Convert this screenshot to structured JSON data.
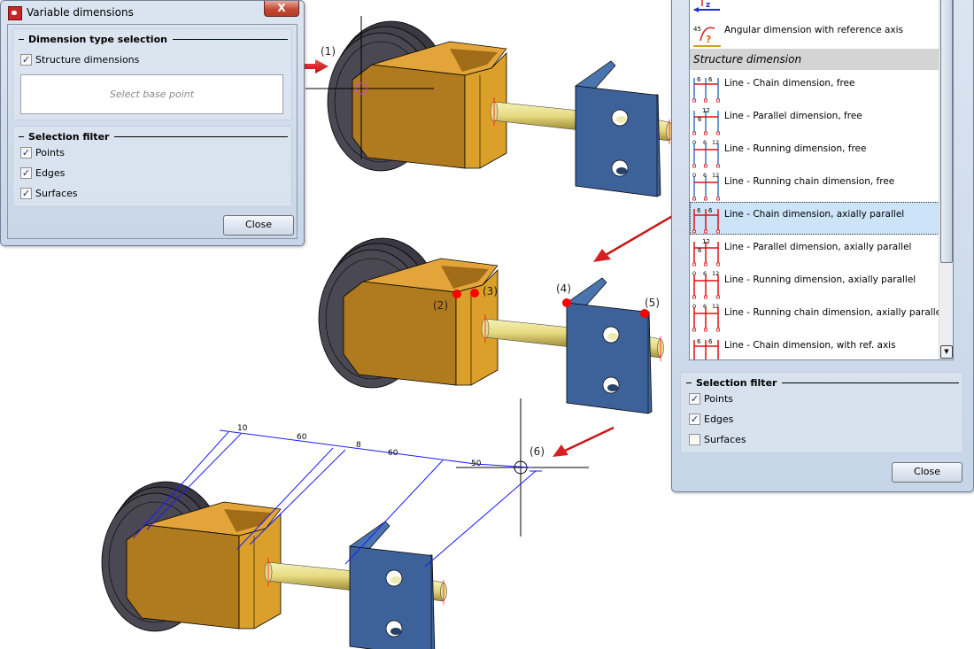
{
  "left_dialog": {
    "title": "Variable dimensions",
    "close_x": "X",
    "type_group": {
      "title": "Dimension type selection",
      "structure_dimensions": {
        "label": "Structure dimensions",
        "checked": true
      },
      "prompt": "Select base point"
    },
    "filter_group": {
      "title": "Selection filter",
      "items": [
        {
          "label": "Points",
          "checked": true
        },
        {
          "label": "Edges",
          "checked": true
        },
        {
          "label": "Surfaces",
          "checked": true
        }
      ]
    },
    "close_button": "Close"
  },
  "right_dialog": {
    "list": {
      "items_before": [
        {
          "label": "",
          "icon": "z-axis-dimension-icon"
        },
        {
          "label": "Angular dimension with reference axis",
          "icon": "angular-dimension-icon"
        }
      ],
      "category": "Structure dimension",
      "items": [
        {
          "label": "Line - Chain dimension, free",
          "icon_numbers": "6 6",
          "style": "free"
        },
        {
          "label": "Line - Parallel dimension, free",
          "icon_numbers": "12 6",
          "style": "free"
        },
        {
          "label": "Line - Running dimension, free",
          "icon_numbers": "0 6 12",
          "style": "free"
        },
        {
          "label": "Line - Running chain dimension, free",
          "icon_numbers": "0 6 12",
          "style": "free"
        },
        {
          "label": "Line - Chain dimension, axially parallel",
          "icon_numbers": "6 6",
          "style": "axial",
          "selected": true
        },
        {
          "label": "Line - Parallel dimension, axially parallel",
          "icon_numbers": "12 6",
          "style": "axial"
        },
        {
          "label": "Line - Running dimension, axially parallel",
          "icon_numbers": "0 6 12",
          "style": "axial"
        },
        {
          "label": "Line - Running chain dimension, axially parallel",
          "icon_numbers": "0 6 12",
          "style": "axial"
        },
        {
          "label": "Line - Chain dimension, with ref. axis",
          "icon_numbers": "6 6",
          "style": "axial"
        }
      ]
    },
    "filter_group": {
      "title": "Selection filter",
      "items": [
        {
          "label": "Points",
          "checked": true
        },
        {
          "label": "Edges",
          "checked": true
        },
        {
          "label": "Surfaces",
          "checked": false
        }
      ]
    },
    "close_button": "Close"
  },
  "viewport": {
    "callouts": [
      "(1)",
      "(2)",
      "(3)",
      "(4)",
      "(5)",
      "(6)"
    ],
    "dimension_values": [
      "10",
      "60",
      "8",
      "60",
      "50"
    ],
    "colors": {
      "bracket": "#c8871e",
      "plate": "#3d6299",
      "wheel": "#46444e",
      "dimension": "#1a1aff",
      "marker": "#ff0000",
      "arrow": "#d42020"
    }
  }
}
